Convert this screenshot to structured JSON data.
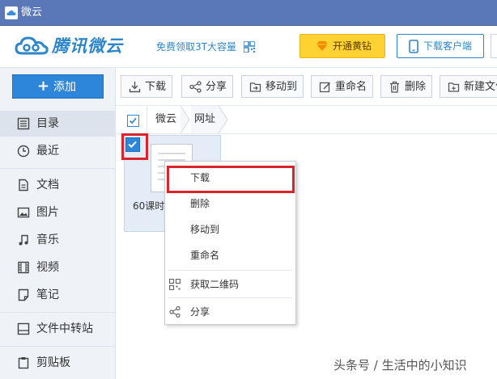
{
  "window": {
    "title": "微云"
  },
  "header": {
    "logo_text": "腾讯微云",
    "promo_text": "免费领取3T大容量",
    "vip_button": "开通黄钻",
    "client_button": "下载客户端"
  },
  "sidebar": {
    "add_button": "添加",
    "items": [
      {
        "label": "目录",
        "icon": "list-icon",
        "active": true
      },
      {
        "label": "最近",
        "icon": "clock-icon"
      },
      {
        "label": "文档",
        "icon": "document-icon"
      },
      {
        "label": "图片",
        "icon": "image-icon"
      },
      {
        "label": "音乐",
        "icon": "music-icon"
      },
      {
        "label": "视频",
        "icon": "video-icon"
      },
      {
        "label": "笔记",
        "icon": "note-icon"
      },
      {
        "label": "文件中转站",
        "icon": "transfer-icon"
      },
      {
        "label": "剪贴板",
        "icon": "clipboard-icon"
      }
    ]
  },
  "toolbar": {
    "download": "下载",
    "share": "分享",
    "move": "移动到",
    "rename": "重命名",
    "delete": "删除",
    "new_folder": "新建文件"
  },
  "breadcrumb": [
    "微云",
    "网址"
  ],
  "file": {
    "name": "60课时"
  },
  "context_menu": {
    "items": [
      "下载",
      "删除",
      "移动到",
      "重命名",
      "获取二维码",
      "分享"
    ]
  },
  "watermark": "头条号 / 生活中的小知识",
  "colors": {
    "accent": "#2d86d9",
    "title_bar": "#5a78b8",
    "highlight": "#d9242e",
    "vip": "#ffd234"
  }
}
